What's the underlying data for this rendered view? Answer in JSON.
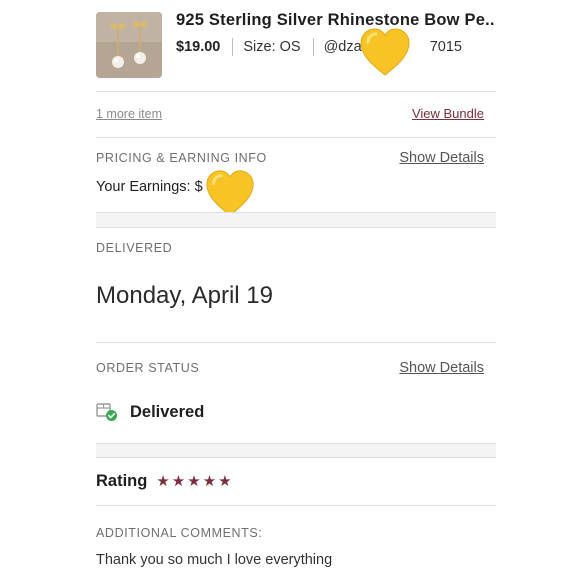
{
  "product": {
    "title": "925 Sterling Silver Rhinestone Bow Pe..",
    "price": "$19.00",
    "size": "Size: OS",
    "handle_start": "@dza",
    "handle_end": "7015",
    "thumbnail": "earring-photo"
  },
  "bundle": {
    "more_items": "1 more item",
    "view_bundle": "View Bundle"
  },
  "pricing": {
    "label": "PRICING & EARNING INFO",
    "show_details": "Show Details",
    "earnings": "Your Earnings: $"
  },
  "delivered": {
    "label": "DELIVERED",
    "date": "Monday, April 19"
  },
  "order_status": {
    "label": "ORDER STATUS",
    "show_details": "Show Details",
    "status": "Delivered"
  },
  "rating": {
    "label": "Rating",
    "stars": 5
  },
  "comments": {
    "label": "ADDITIONAL COMMENTS:",
    "text": "Thank you so much I love everything"
  },
  "colors": {
    "accent": "#7b2e3d",
    "heart": "#f7c325",
    "success": "#3aa856"
  },
  "emoji": [
    "yellow-heart-emoji",
    "yellow-heart-emoji"
  ]
}
